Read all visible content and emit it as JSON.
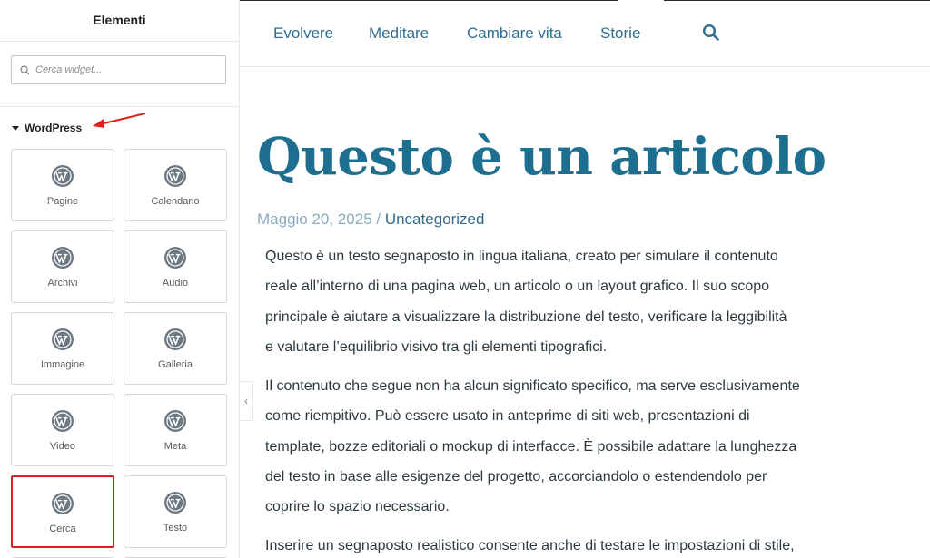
{
  "panel": {
    "title": "Elementi",
    "search": {
      "placeholder": "Cerca widget..."
    },
    "category": {
      "label": "WordPress"
    },
    "widgets": [
      {
        "label": "Pagine",
        "icon": "wordpress-icon"
      },
      {
        "label": "Calendario",
        "icon": "wordpress-icon"
      },
      {
        "label": "Archivi",
        "icon": "wordpress-icon"
      },
      {
        "label": "Audio",
        "icon": "wordpress-icon"
      },
      {
        "label": "Immagine",
        "icon": "wordpress-icon"
      },
      {
        "label": "Galleria",
        "icon": "wordpress-icon"
      },
      {
        "label": "Video",
        "icon": "wordpress-icon"
      },
      {
        "label": "Meta",
        "icon": "wordpress-icon"
      },
      {
        "label": "Cerca",
        "icon": "wordpress-icon",
        "highlighted": true
      },
      {
        "label": "Testo",
        "icon": "wordpress-icon"
      }
    ],
    "collapse_glyph": "‹"
  },
  "nav": {
    "items": [
      "Evolvere",
      "Meditare",
      "Cambiare vita",
      "Storie"
    ],
    "search_icon": "search-icon"
  },
  "article": {
    "title": "Questo è un articolo",
    "date": "Maggio 20, 2025",
    "separator": " / ",
    "category": "Uncategorized",
    "lines": [
      "Questo è un testo segnaposto in lingua italiana, creato per simulare il contenuto",
      "reale all’interno di una pagina web, un articolo o un layout grafico. Il suo scopo",
      "principale è aiutare a visualizzare la distribuzione del testo, verificare la leggibilità",
      "e valutare l’equilibrio visivo tra gli elementi tipografici.",
      "Il contenuto che segue non ha alcun significato specifico, ma serve esclusivamente",
      "come riempitivo. Può essere usato in anteprime di siti web, presentazioni di",
      "template, bozze editoriali o mockup di interfacce. È possibile adattare la lunghezza",
      "del testo in base alle esigenze del progetto, accorciandolo o estendendolo per",
      "coprire lo spazio necessario.",
      "Inserire un segnaposto realistico consente anche di testare le impostazioni di stile,"
    ]
  },
  "colors": {
    "link": "#2f6d8f",
    "title": "#1e6f8f",
    "highlight": "#e0201c",
    "annotation_arrow": "#e0201c"
  }
}
